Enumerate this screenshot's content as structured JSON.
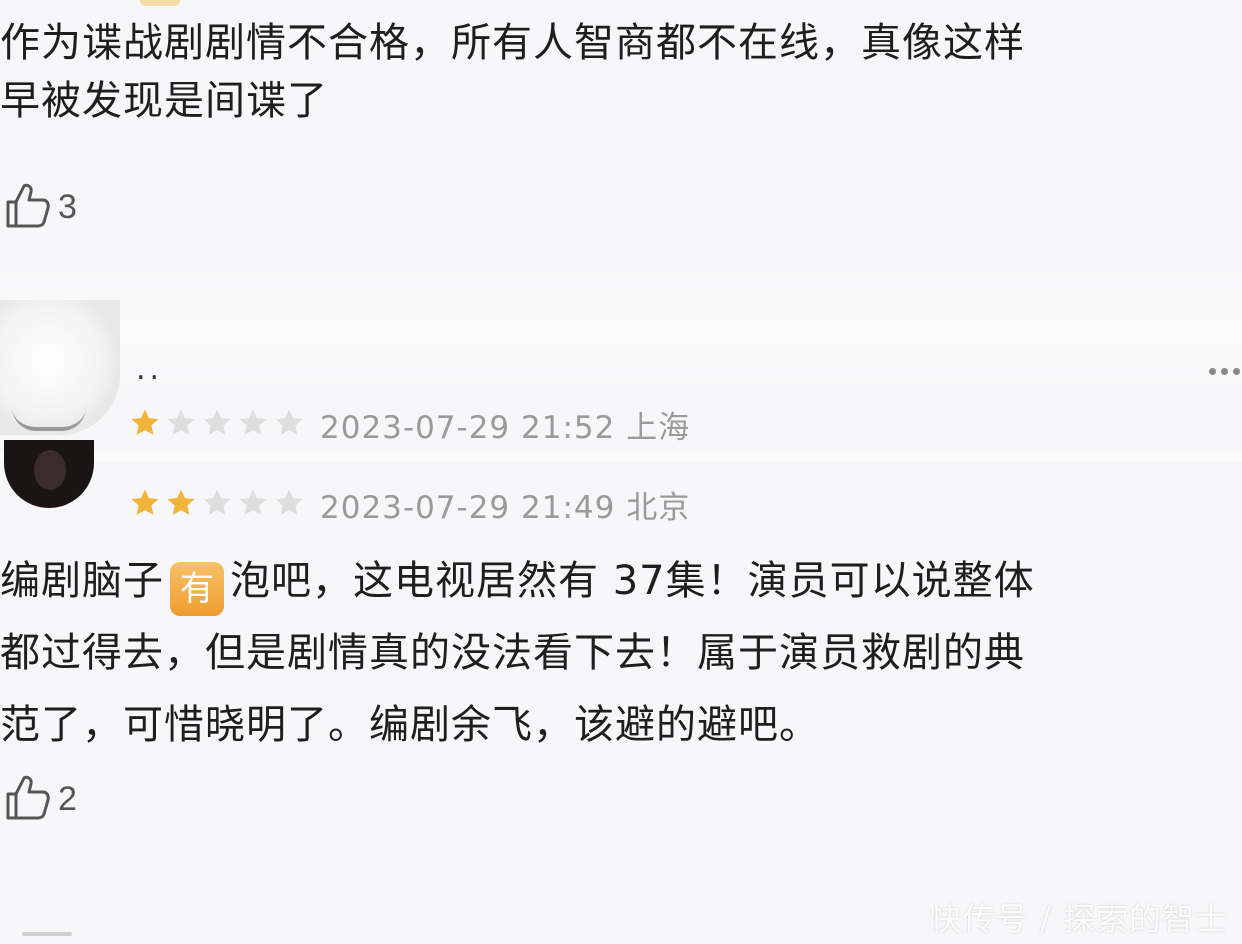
{
  "comments": [
    {
      "text_line1": "作为谍战剧剧情不合格，所有人智商都不在线，真像这样",
      "text_line2": "早被发现是间谍了",
      "likes": "3"
    },
    {
      "username": "..",
      "rating": 1,
      "max_rating": 5,
      "timestamp": "2023-07-29 21:52 上海"
    },
    {
      "rating": 2,
      "max_rating": 5,
      "timestamp": "2023-07-29 21:49 北京",
      "text_line1_before": "编剧脑子",
      "emoji_text": "有",
      "text_line1_after": "泡吧，这电视居然有 37集！演员可以说整体",
      "text_line2": "都过得去，但是剧情真的没法看下去！属于演员救剧的典",
      "text_line3": "范了，可惜晓明了。编剧余飞，该避的避吧。",
      "likes": "2"
    }
  ],
  "colors": {
    "star_filled": "#f0b43a",
    "star_empty": "#dedede",
    "text": "#1e1e1e",
    "meta": "#9a9a9a"
  },
  "icons": [
    "thumbs-up-icon",
    "star-icon",
    "more-icon",
    "avatar"
  ],
  "watermark": "快传号 / 探索的智士"
}
